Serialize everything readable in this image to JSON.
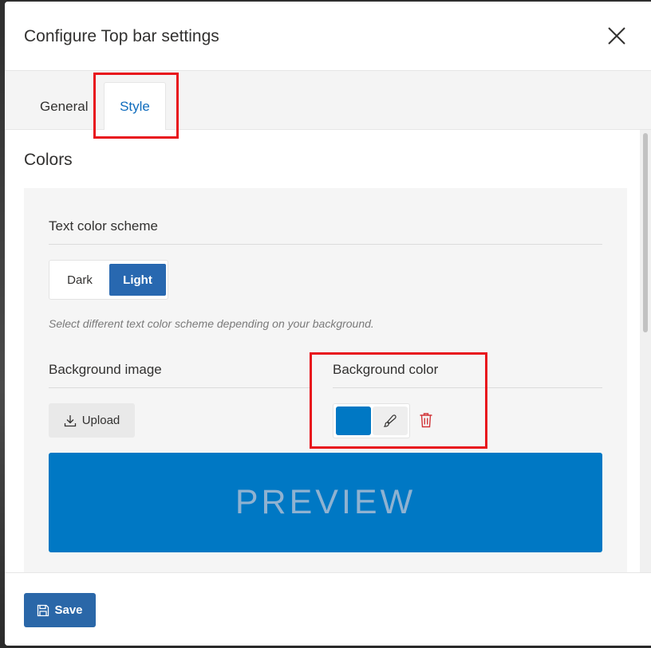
{
  "dialog": {
    "title": "Configure Top bar settings",
    "close_icon": "close-icon"
  },
  "tabs": [
    {
      "label": "General",
      "active": false
    },
    {
      "label": "Style",
      "active": true
    }
  ],
  "colors_section": {
    "title": "Colors",
    "text_color_scheme": {
      "label": "Text color scheme",
      "options": [
        "Dark",
        "Light"
      ],
      "selected": "Light",
      "hint": "Select different text color scheme depending on your background."
    },
    "background_image": {
      "label": "Background image",
      "upload_label": "Upload",
      "upload_icon": "download-icon"
    },
    "background_color": {
      "label": "Background color",
      "value": "#0078c4",
      "brush_icon": "brush-icon",
      "delete_icon": "trash-icon"
    },
    "preview": {
      "label": "PREVIEW",
      "background": "#0078c4"
    }
  },
  "footer": {
    "save_label": "Save",
    "save_icon": "floppy-disk-icon"
  },
  "colors": {
    "accent": "#0f6cbd",
    "primary_button": "#2a67a8",
    "selected_segment": "#2868b0",
    "highlight": "#e8131c",
    "delete": "#d13438"
  }
}
